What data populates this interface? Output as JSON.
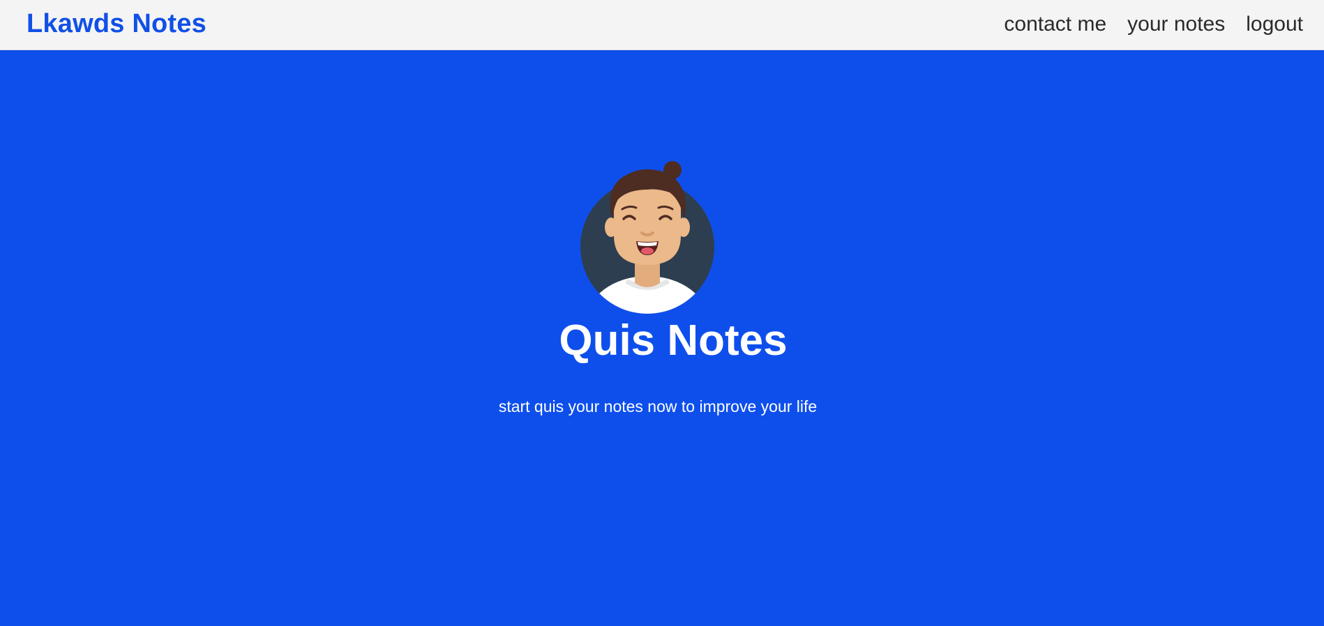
{
  "navbar": {
    "brand": "Lkawds Notes",
    "links": [
      {
        "label": "contact me"
      },
      {
        "label": "your notes"
      },
      {
        "label": "logout"
      }
    ]
  },
  "hero": {
    "avatar_icon": "smiling-man-avatar-icon",
    "title": "Quis Notes",
    "subtitle": "start quis your notes now to improve your life"
  },
  "colors": {
    "background": "#0e4fec",
    "navbar_bg": "#f4f4f4",
    "brand": "#1150e6",
    "hero_text": "#ffffff",
    "avatar_circle": "#2d3e50",
    "skin": "#ecb98a",
    "hair": "#4d2c22"
  }
}
